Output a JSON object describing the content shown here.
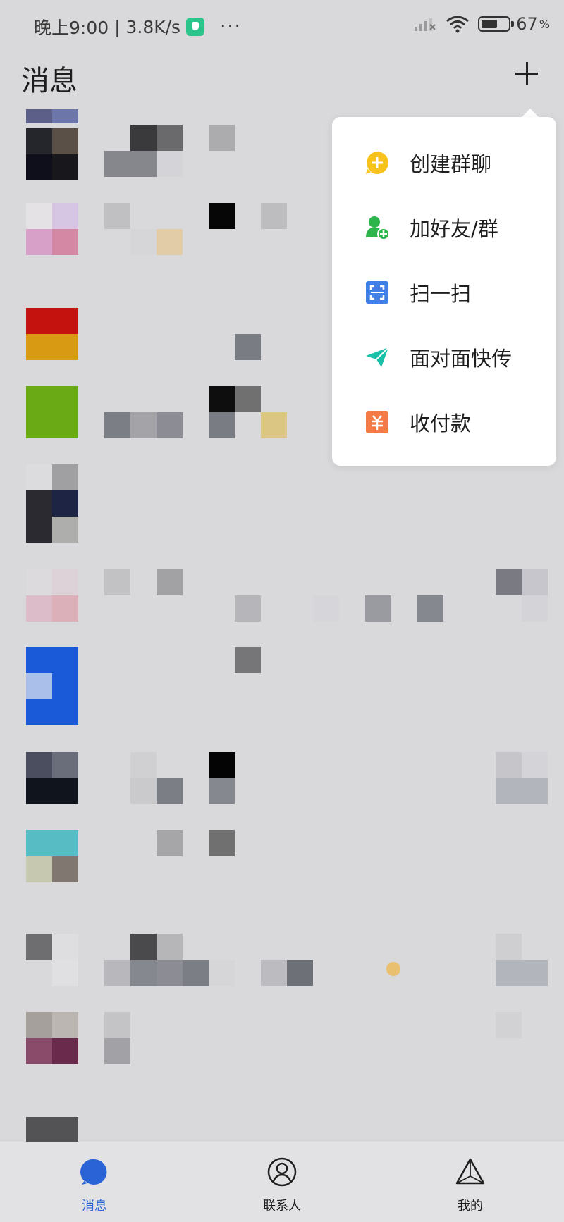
{
  "status_bar": {
    "time": "晚上9:00",
    "network_speed": "3.8K/s",
    "more": "···",
    "battery_percent": "67",
    "battery_unit": "%",
    "battery_level": 0.67
  },
  "header": {
    "title": "消息"
  },
  "popup_menu": {
    "items": [
      {
        "label": "创建群聊",
        "icon": "add-circle-icon",
        "color": "#f7c21c"
      },
      {
        "label": "加好友/群",
        "icon": "add-friend-icon",
        "color": "#2bb54a"
      },
      {
        "label": "扫一扫",
        "icon": "scan-icon",
        "color": "#3f7fe6"
      },
      {
        "label": "面对面快传",
        "icon": "send-icon",
        "color": "#19c1a8"
      },
      {
        "label": "收付款",
        "icon": "payment-icon",
        "color": "#f57a45"
      }
    ]
  },
  "tab_bar": {
    "tabs": [
      {
        "label": "消息",
        "icon": "message-icon",
        "active": true
      },
      {
        "label": "联系人",
        "icon": "contacts-icon",
        "active": false
      },
      {
        "label": "我的",
        "icon": "profile-icon",
        "active": false
      }
    ],
    "active_color": "#2a63d6"
  },
  "colors": {
    "background": "#d9d9db",
    "menu_background": "#ffffff"
  }
}
